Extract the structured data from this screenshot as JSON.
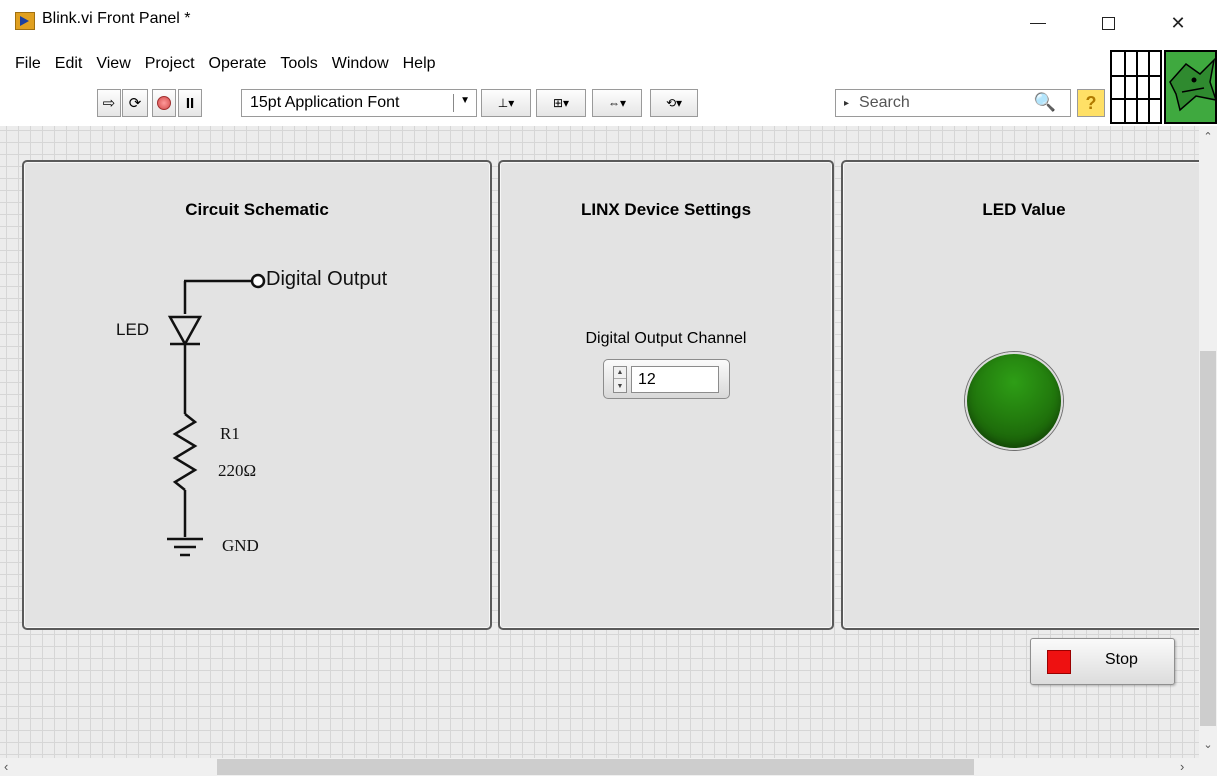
{
  "window": {
    "title": "Blink.vi Front Panel *",
    "minimize_icon": "minimize-icon",
    "maximize_icon": "maximize-icon",
    "close_glyph": "✕"
  },
  "menu": [
    "File",
    "Edit",
    "View",
    "Project",
    "Operate",
    "Tools",
    "Window",
    "Help"
  ],
  "toolbar": {
    "run_glyph": "⇨",
    "run_continuously_glyph": "⟳",
    "pause_glyph": "II",
    "font": "15pt Application Font",
    "font_arrow": "▼",
    "align_glyph": "⊥▾",
    "distribute_glyph": "⊞▾",
    "resize_glyph": "⇔▾",
    "reorder_glyph": "⟲▾",
    "search_placeholder": "Search",
    "search_triangle": "▸",
    "search_icon_glyph": "🔍",
    "help_glyph": "?"
  },
  "circuit": {
    "title": "Circuit Schematic",
    "digital_output_label": "Digital Output",
    "led_label": "LED",
    "resistor_name": "R1",
    "resistor_value": "220Ω",
    "ground_label": "GND"
  },
  "linx": {
    "title": "LINX Device Settings",
    "channel_label": "Digital Output Channel",
    "channel_value": "12",
    "spin_up": "▲",
    "spin_down": "▼"
  },
  "led": {
    "title": "LED Value",
    "state": "on",
    "color": "#2e8b14"
  },
  "stop": {
    "label": "Stop",
    "indicator_color": "#ee1111"
  },
  "scrollbars": {
    "up": "⌃",
    "down": "⌄",
    "left": "‹",
    "right": "›"
  },
  "colors": {
    "panel_background": "#ececec",
    "section_background": "#e3e3e3",
    "help_icon": "#ffe066"
  }
}
